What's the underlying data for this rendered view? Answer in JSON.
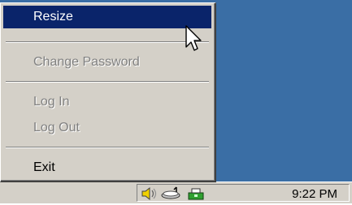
{
  "menu": {
    "items": [
      {
        "label": "Resize",
        "state": "selected"
      },
      {
        "label": "Change Password",
        "state": "disabled"
      },
      {
        "label": "Log In",
        "state": "disabled"
      },
      {
        "label": "Log Out",
        "state": "disabled"
      },
      {
        "label": "Exit",
        "state": "enabled"
      }
    ]
  },
  "taskbar": {
    "clock": "9:22 PM",
    "tray_icons": [
      "speaker-icon",
      "network-icon",
      "app-tray-icon"
    ]
  },
  "colors": {
    "desktop": "#3a6ea5",
    "highlight": "#0a246a",
    "face": "#d4d0c8"
  }
}
